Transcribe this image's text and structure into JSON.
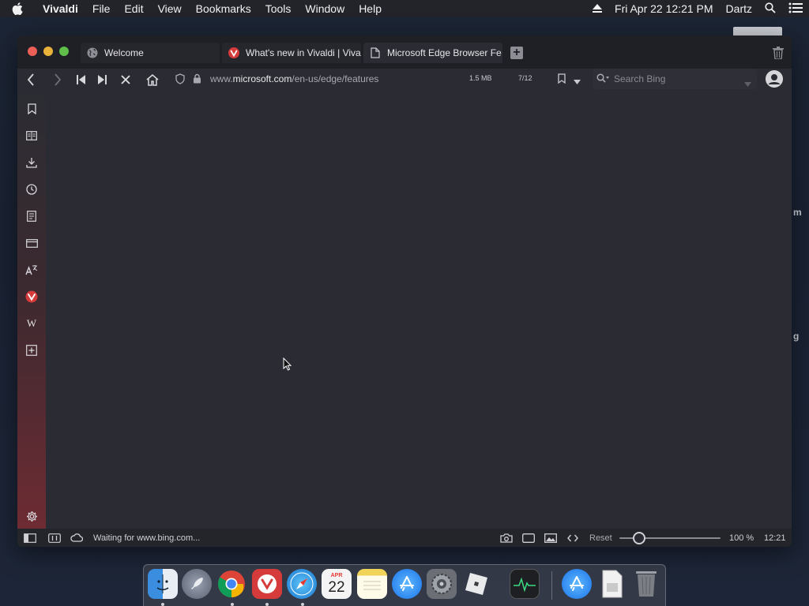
{
  "menubar": {
    "app_name": "Vivaldi",
    "menus": [
      "File",
      "Edit",
      "View",
      "Bookmarks",
      "Tools",
      "Window",
      "Help"
    ],
    "datetime": "Fri Apr 22  12:21 PM",
    "user": "Dartz"
  },
  "desktop": {
    "peek_text_1": "m",
    "peek_text_2": "g"
  },
  "tabs": [
    {
      "title": "Welcome",
      "icon": "globe-icon"
    },
    {
      "title": "What's new in Vivaldi | Viva",
      "icon": "vivaldi-icon"
    },
    {
      "title": "Microsoft Edge Browser Fe",
      "icon": "document-icon",
      "active": true
    }
  ],
  "address": {
    "url_prefix": "www.",
    "url_domain": "microsoft.com",
    "url_path": "/en-us/edge/features",
    "page_size": "1.5 MB",
    "resource_count": "7/12"
  },
  "search": {
    "placeholder": "Search Bing"
  },
  "sidebar": {
    "items": [
      "bookmarks-icon",
      "reading-list-icon",
      "downloads-icon",
      "history-icon",
      "notes-icon",
      "window-panel-icon",
      "translate-icon",
      "vivaldi-web-panel-icon",
      "wikipedia-icon",
      "add-web-panel-icon"
    ],
    "wikipedia_glyph": "W"
  },
  "statusbar": {
    "status_text": "Waiting for www.bing.com...",
    "reset_label": "Reset",
    "zoom_percent": "100 %",
    "zoom_value": 100,
    "clock": "12:21"
  },
  "dock": {
    "calendar_month": "APR",
    "calendar_day": "22",
    "apps": [
      "Finder",
      "Launchpad",
      "Google Chrome",
      "Vivaldi",
      "Safari",
      "Calendar",
      "Notes",
      "App Store",
      "System Preferences",
      "Roblox",
      "Activity Monitor",
      "App Store",
      "Preview",
      "Trash"
    ]
  },
  "colors": {
    "accent_red": "#d63b3b",
    "window_bg": "#2b2c33",
    "tabbar_bg": "#1f2025"
  }
}
